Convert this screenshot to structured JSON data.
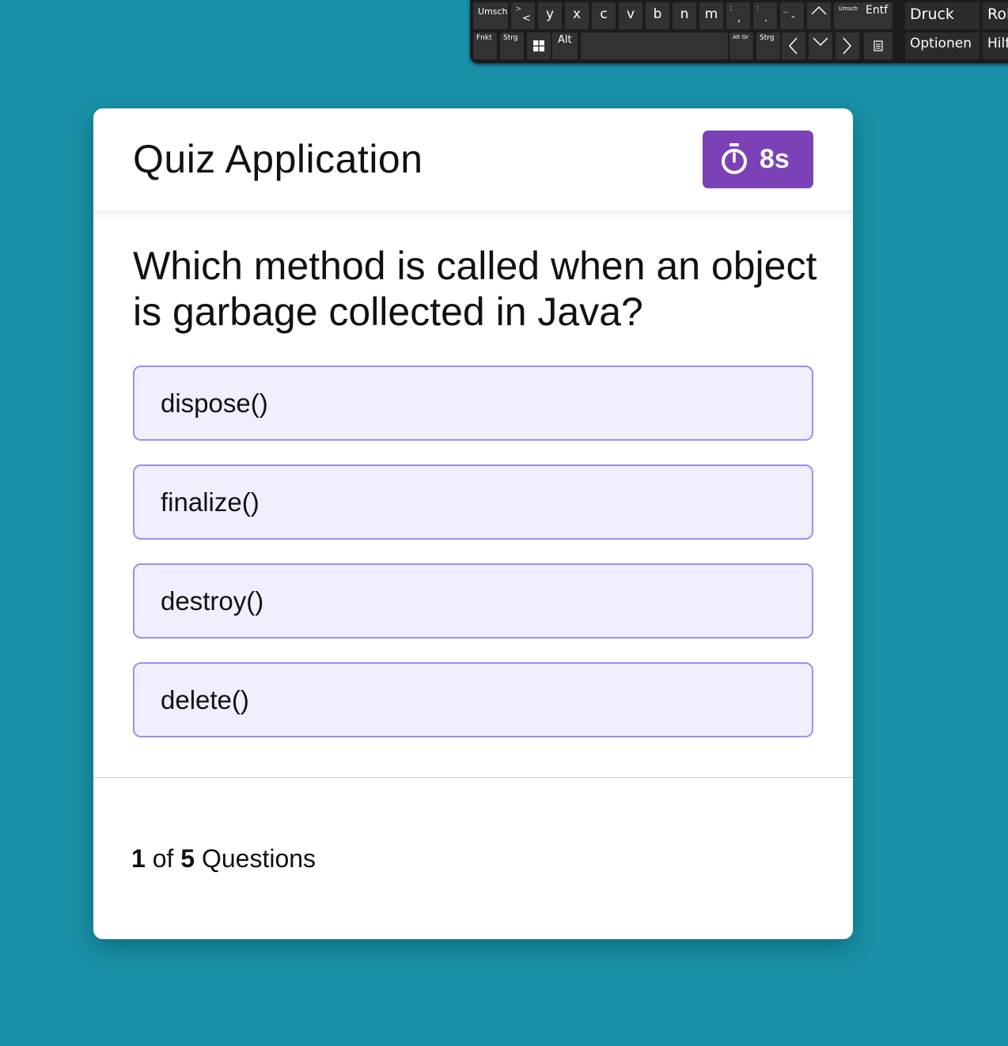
{
  "keyboard": {
    "row1": [
      "Umsch",
      ">",
      "<",
      "y",
      "x",
      "c",
      "v",
      "b",
      "n",
      "m",
      ";",
      ",",
      ":",
      ".",
      "_",
      "-",
      "Umsch",
      "Entf"
    ],
    "row2": [
      "Fnkt",
      "Strg",
      "Alt",
      "Alt Gr",
      "Strg"
    ],
    "side": [
      "Druck",
      "Rol",
      "Optionen",
      "Hilf"
    ]
  },
  "quiz": {
    "title": "Quiz Application",
    "timer": "8s",
    "question": "Which method is called when an object is garbage collected in Java?",
    "options": [
      "dispose()",
      "finalize()",
      "destroy()",
      "delete()"
    ],
    "progress": {
      "current": "1",
      "of": "of",
      "total": "5",
      "label": "Questions"
    }
  },
  "colors": {
    "background": "#1890a7",
    "timer_bg": "#7b42b8",
    "option_border": "#9f8ef0",
    "option_bg": "#f1eefe"
  },
  "icons": [
    "windows-icon",
    "arrow-up-icon",
    "arrow-down-icon",
    "arrow-left-icon",
    "arrow-right-icon",
    "menu-key-icon",
    "stopwatch-icon"
  ]
}
